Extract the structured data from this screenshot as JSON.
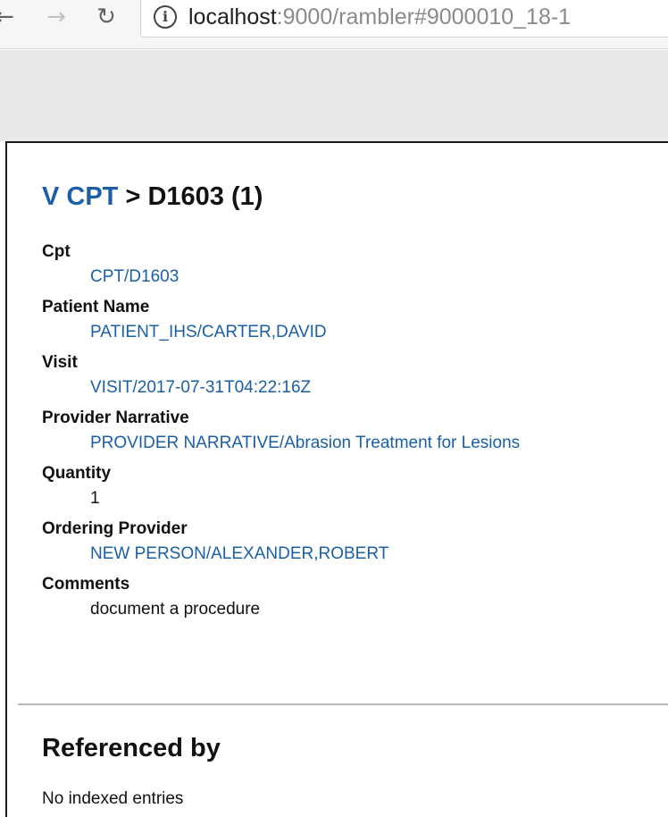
{
  "browser": {
    "back_glyph": "←",
    "forward_glyph": "→",
    "reload_glyph": "↻",
    "url_host": "localhost",
    "url_rest": ":9000/rambler#9000010_18-1"
  },
  "page": {
    "breadcrumb_link": "V CPT",
    "breadcrumb_sep": " > ",
    "breadcrumb_current": "D1603 (1)",
    "fields": [
      {
        "label": "Cpt",
        "value": "CPT/D1603",
        "is_link": true
      },
      {
        "label": "Patient Name",
        "value": "PATIENT_IHS/CARTER,DAVID",
        "is_link": true
      },
      {
        "label": "Visit",
        "value": "VISIT/2017-07-31T04:22:16Z",
        "is_link": true
      },
      {
        "label": "Provider Narrative",
        "value": "PROVIDER NARRATIVE/Abrasion Treatment for Lesions",
        "is_link": true
      },
      {
        "label": "Quantity",
        "value": "1",
        "is_link": false
      },
      {
        "label": "Ordering Provider",
        "value": "NEW PERSON/ALEXANDER,ROBERT",
        "is_link": true
      },
      {
        "label": "Comments",
        "value": "document a procedure",
        "is_link": false
      }
    ],
    "referenced_heading": "Referenced by",
    "referenced_empty": "No indexed entries"
  },
  "colors": {
    "link": "#1a5fa8",
    "text": "#111111"
  }
}
